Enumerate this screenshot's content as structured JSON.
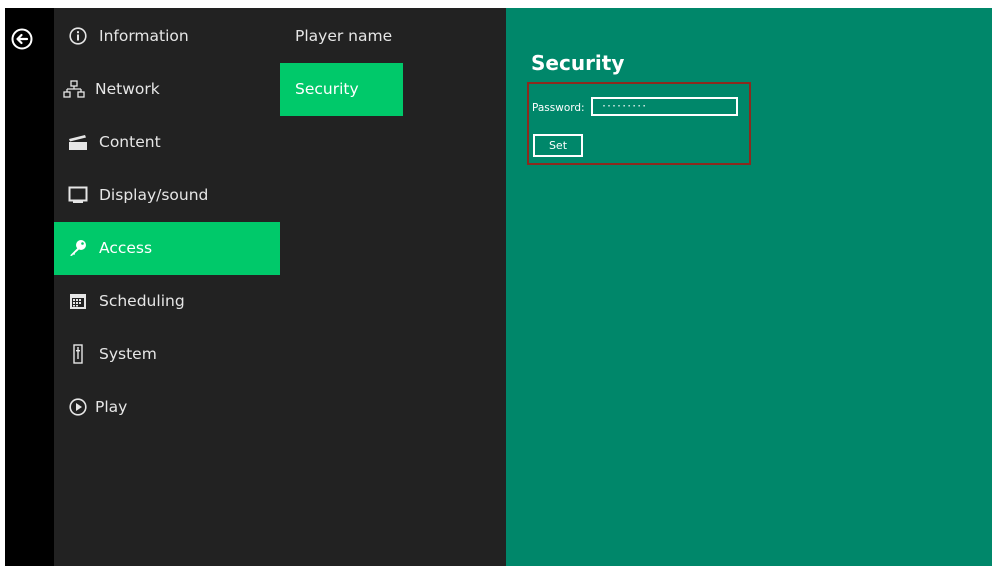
{
  "colors": {
    "menu_bg": "#222222",
    "rail_bg": "#000000",
    "active_bg": "#00c96a",
    "panel_bg": "#00876a",
    "highlight_border": "#8b2a1e"
  },
  "back_button": {
    "icon": "back-arrow-icon"
  },
  "menu": {
    "items": [
      {
        "label": "Information",
        "icon": "info-icon"
      },
      {
        "label": "Network",
        "icon": "network-icon"
      },
      {
        "label": "Content",
        "icon": "clapperboard-icon"
      },
      {
        "label": "Display/sound",
        "icon": "monitor-icon"
      },
      {
        "label": "Access",
        "icon": "key-icon",
        "active": true
      },
      {
        "label": "Scheduling",
        "icon": "calendar-icon"
      },
      {
        "label": "System",
        "icon": "system-icon"
      },
      {
        "label": "Play",
        "icon": "play-icon"
      }
    ]
  },
  "submenu": {
    "items": [
      {
        "label": "Player name"
      },
      {
        "label": "Security",
        "active": true
      }
    ]
  },
  "panel": {
    "title": "Security",
    "password_label": "Password:",
    "password_value": "·········",
    "set_label": "Set"
  }
}
